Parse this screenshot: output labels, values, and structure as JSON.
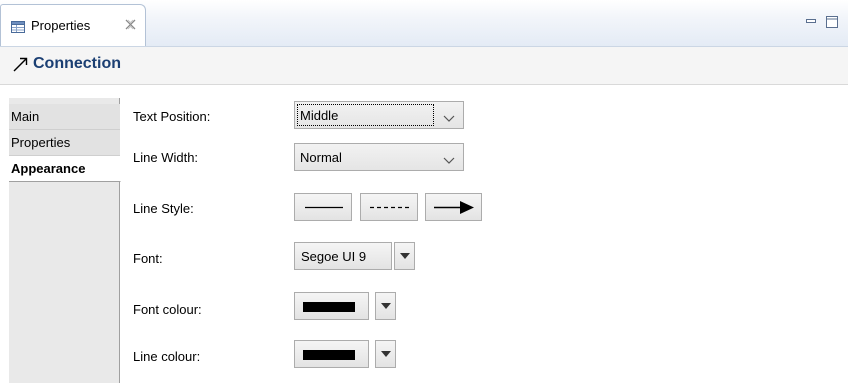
{
  "view_tab": {
    "title": "Properties",
    "icon": "properties-table-icon",
    "close_icon": "close-icon"
  },
  "window_controls": {
    "minimize_icon": "minimize-icon",
    "maximize_icon": "maximize-icon"
  },
  "header": {
    "icon": "connection-arrow-icon",
    "title": "Connection"
  },
  "side_tabs": [
    {
      "label": "Main"
    },
    {
      "label": "Properties"
    },
    {
      "label": "Appearance",
      "selected": true
    }
  ],
  "form": {
    "text_position": {
      "label": "Text Position:",
      "value": "Middle"
    },
    "line_width": {
      "label": "Line Width:",
      "value": "Normal"
    },
    "line_style": {
      "label": "Line Style:",
      "options": [
        "solid-line-icon",
        "dashed-line-icon",
        "arrow-line-icon"
      ]
    },
    "font": {
      "label": "Font:",
      "value": "Segoe UI 9"
    },
    "font_colour": {
      "label": "Font colour:",
      "color": "#000000"
    },
    "line_colour": {
      "label": "Line colour:",
      "color": "#000000"
    }
  },
  "colors": {
    "header_title": "#1b3f73",
    "tab_border": "#b3c2d6"
  }
}
